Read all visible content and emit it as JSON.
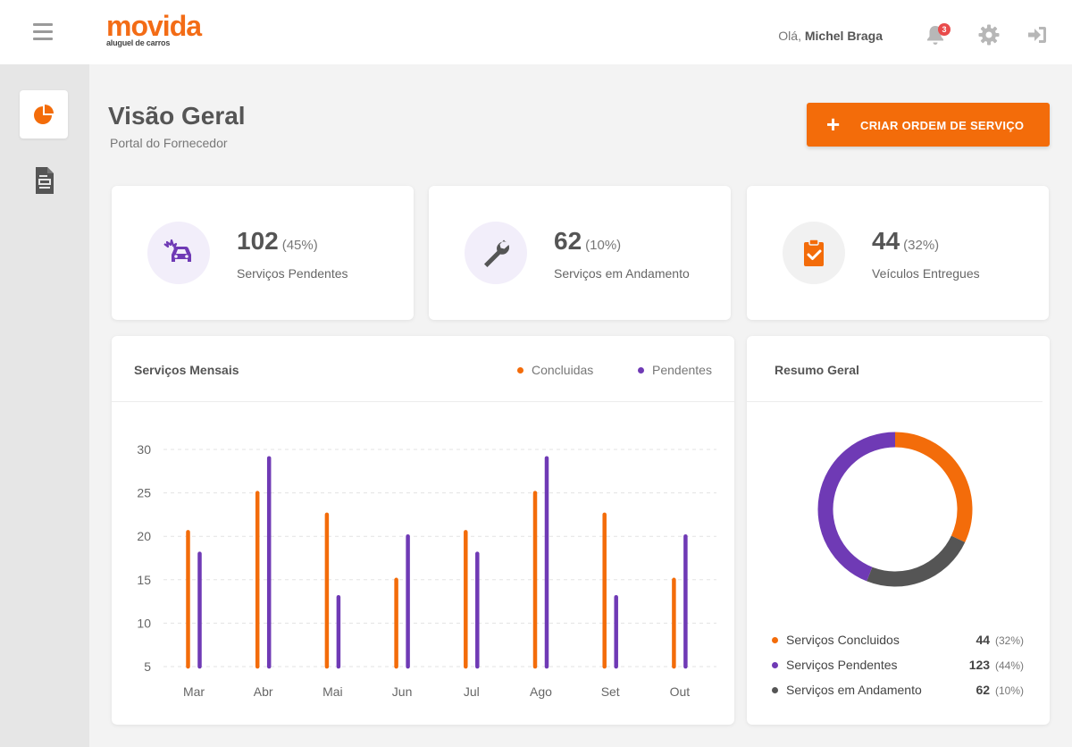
{
  "header": {
    "logo_text": "movida",
    "logo_sub": "aluguel de carros",
    "greeting_prefix": "Olá,",
    "user_name": "Michel Braga",
    "notification_count": "3"
  },
  "page": {
    "title": "Visão Geral",
    "subtitle": "Portal do Fornecedor",
    "create_button": "CRIAR ORDEM DE SERVIÇO"
  },
  "stats": [
    {
      "value": "102",
      "percent": "(45%)",
      "label": "Serviços Pendentes",
      "icon": "car-crash-icon",
      "color": "#6f3ab5"
    },
    {
      "value": "62",
      "percent": "(10%)",
      "label": "Serviços em Andamento",
      "icon": "wrench-icon",
      "color": "#555555"
    },
    {
      "value": "44",
      "percent": "(32%)",
      "label": "Veículos Entregues",
      "icon": "clipboard-check-icon",
      "color": "#f36c0a"
    }
  ],
  "monthly_chart": {
    "title": "Serviços Mensais",
    "legend": [
      "Concluidas",
      "Pendentes"
    ]
  },
  "summary": {
    "title": "Resumo Geral",
    "rows": [
      {
        "label": "Serviços Concluidos",
        "value": "44",
        "percent": "(32%)",
        "color": "#f36c0a"
      },
      {
        "label": "Serviços Pendentes",
        "value": "123",
        "percent": "(44%)",
        "color": "#6f3ab5"
      },
      {
        "label": "Serviços em Andamento",
        "value": "62",
        "percent": "(10%)",
        "color": "#555555"
      }
    ]
  },
  "colors": {
    "accent": "#f36c0a",
    "purple": "#6f3ab5",
    "dark": "#555555"
  },
  "chart_data": [
    {
      "type": "bar",
      "title": "Serviços Mensais",
      "categories": [
        "Mar",
        "Abr",
        "Mai",
        "Jun",
        "Jul",
        "Ago",
        "Set",
        "Out"
      ],
      "series": [
        {
          "name": "Concluidas",
          "color": "#f36c0a",
          "values": [
            20.5,
            25,
            22.5,
            15,
            20.5,
            25,
            22.5,
            15
          ]
        },
        {
          "name": "Pendentes",
          "color": "#6f3ab5",
          "values": [
            18,
            29,
            13,
            20,
            18,
            29,
            13,
            20
          ]
        }
      ],
      "yticks": [
        5,
        10,
        15,
        20,
        25,
        30
      ],
      "ylim": [
        5,
        30
      ],
      "grid": true,
      "legend_position": "top-right"
    },
    {
      "type": "pie",
      "title": "Resumo Geral",
      "donut": true,
      "labels": [
        "Serviços Concluidos",
        "Serviços Andamento",
        "Serviços Pendentes"
      ],
      "values": [
        32,
        24,
        44
      ],
      "colors": [
        "#f36c0a",
        "#555555",
        "#6f3ab5"
      ]
    }
  ]
}
